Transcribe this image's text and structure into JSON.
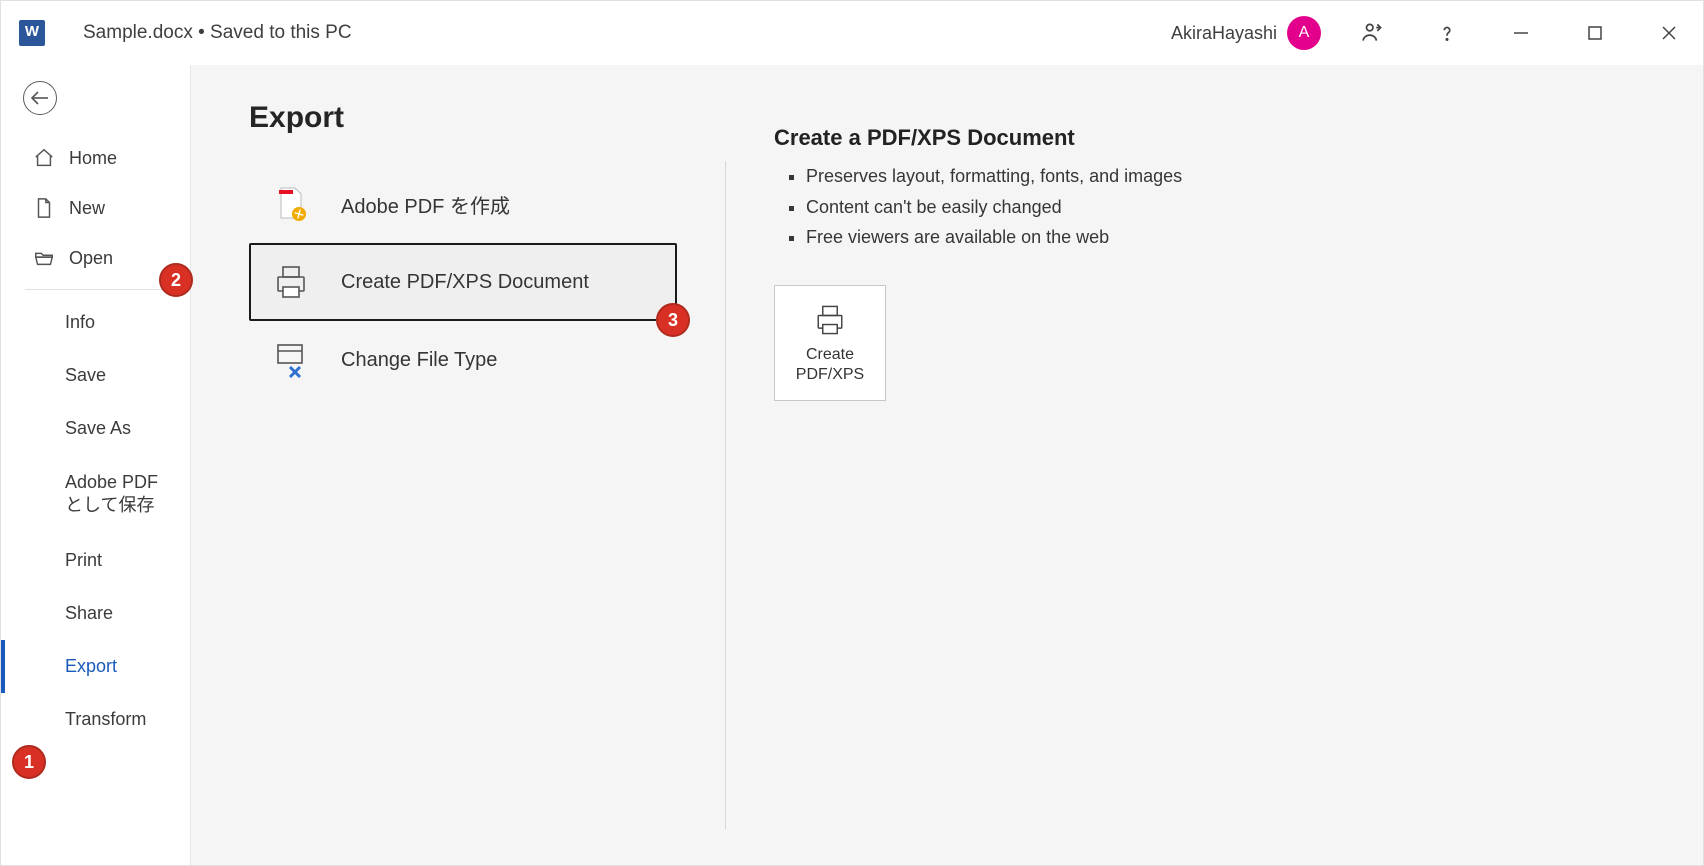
{
  "titlebar": {
    "doc": "Sample.docx  •  Saved to this PC",
    "user_name": "AkiraHayashi",
    "avatar_letter": "A"
  },
  "sidebar": {
    "home": "Home",
    "new": "New",
    "open": "Open",
    "info": "Info",
    "save": "Save",
    "save_as": "Save As",
    "adobe_pdf_save": "Adobe PDF として保存",
    "print": "Print",
    "share": "Share",
    "export": "Export",
    "transform": "Transform"
  },
  "main": {
    "page_title": "Export",
    "options": {
      "adobe": "Adobe PDF を作成",
      "pdfxps": "Create PDF/XPS Document",
      "changetype": "Change File Type"
    },
    "detail": {
      "heading": "Create a PDF/XPS Document",
      "b1": "Preserves layout, formatting, fonts, and images",
      "b2": "Content can't be easily changed",
      "b3": "Free viewers are available on the web",
      "button": "Create PDF/XPS"
    }
  },
  "callouts": {
    "c1": "1",
    "c2": "2",
    "c3": "3"
  }
}
